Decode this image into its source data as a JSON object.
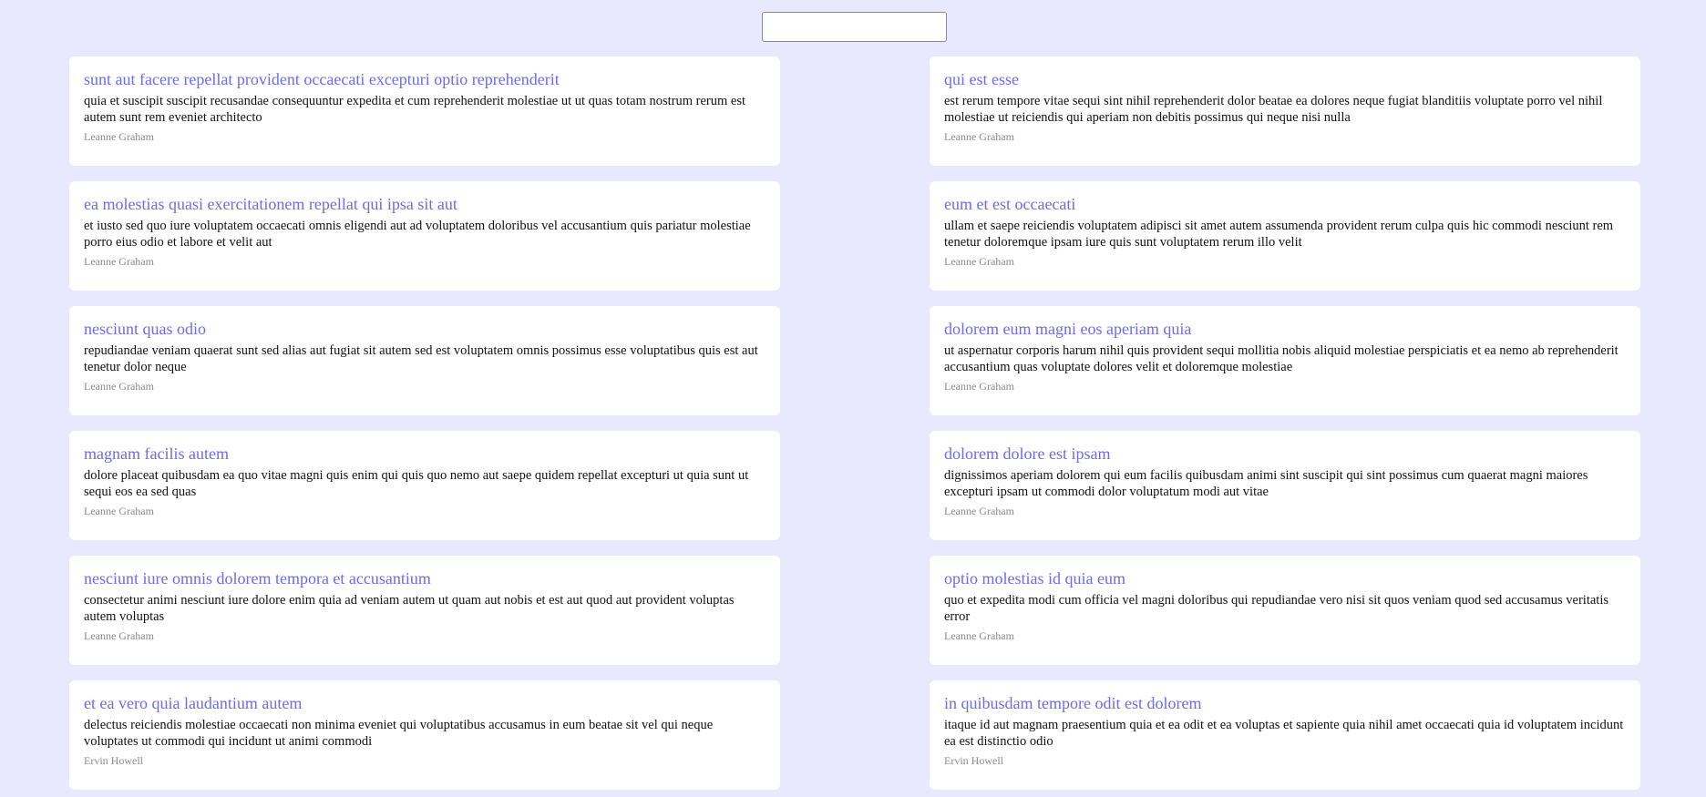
{
  "search": {
    "value": "",
    "placeholder": ""
  },
  "posts": [
    {
      "title": "sunt aut facere repellat provident occaecati excepturi optio reprehenderit",
      "body": "quia et suscipit suscipit recusandae consequuntur expedita et cum reprehenderit molestiae ut ut quas totam nostrum rerum est autem sunt rem eveniet architecto",
      "author": "Leanne Graham"
    },
    {
      "title": "qui est esse",
      "body": "est rerum tempore vitae sequi sint nihil reprehenderit dolor beatae ea dolores neque fugiat blanditiis voluptate porro vel nihil molestiae ut reiciendis qui aperiam non debitis possimus qui neque nisi nulla",
      "author": "Leanne Graham"
    },
    {
      "title": "ea molestias quasi exercitationem repellat qui ipsa sit aut",
      "body": "et iusto sed quo iure voluptatem occaecati omnis eligendi aut ad voluptatem doloribus vel accusantium quis pariatur molestiae porro eius odio et labore et velit aut",
      "author": "Leanne Graham"
    },
    {
      "title": "eum et est occaecati",
      "body": "ullam et saepe reiciendis voluptatem adipisci sit amet autem assumenda provident rerum culpa quis hic commodi nesciunt rem tenetur doloremque ipsam iure quis sunt voluptatem rerum illo velit",
      "author": "Leanne Graham"
    },
    {
      "title": "nesciunt quas odio",
      "body": "repudiandae veniam quaerat sunt sed alias aut fugiat sit autem sed est voluptatem omnis possimus esse voluptatibus quis est aut tenetur dolor neque",
      "author": "Leanne Graham"
    },
    {
      "title": "dolorem eum magni eos aperiam quia",
      "body": "ut aspernatur corporis harum nihil quis provident sequi mollitia nobis aliquid molestiae perspiciatis et ea nemo ab reprehenderit accusantium quas voluptate dolores velit et doloremque molestiae",
      "author": "Leanne Graham"
    },
    {
      "title": "magnam facilis autem",
      "body": "dolore placeat quibusdam ea quo vitae magni quis enim qui quis quo nemo aut saepe quidem repellat excepturi ut quia sunt ut sequi eos ea sed quas",
      "author": "Leanne Graham"
    },
    {
      "title": "dolorem dolore est ipsam",
      "body": "dignissimos aperiam dolorem qui eum facilis quibusdam animi sint suscipit qui sint possimus cum quaerat magni maiores excepturi ipsam ut commodi dolor voluptatum modi aut vitae",
      "author": "Leanne Graham"
    },
    {
      "title": "nesciunt iure omnis dolorem tempora et accusantium",
      "body": "consectetur animi nesciunt iure dolore enim quia ad veniam autem ut quam aut nobis et est aut quod aut provident voluptas autem voluptas",
      "author": "Leanne Graham"
    },
    {
      "title": "optio molestias id quia eum",
      "body": "quo et expedita modi cum officia vel magni doloribus qui repudiandae vero nisi sit quos veniam quod sed accusamus veritatis error",
      "author": "Leanne Graham"
    },
    {
      "title": "et ea vero quia laudantium autem",
      "body": "delectus reiciendis molestiae occaecati non minima eveniet qui voluptatibus accusamus in eum beatae sit vel qui neque voluptates ut commodi qui incidunt ut animi commodi",
      "author": "Ervin Howell"
    },
    {
      "title": "in quibusdam tempore odit est dolorem",
      "body": "itaque id aut magnam praesentium quia et ea odit et ea voluptas et sapiente quia nihil amet occaecati quia id voluptatem incidunt ea est distinctio odio",
      "author": "Ervin Howell"
    }
  ],
  "colors": {
    "background": "#e8e8ff",
    "card": "#ffffff",
    "title": "#6b6bf0",
    "author": "#8a8a8a"
  }
}
